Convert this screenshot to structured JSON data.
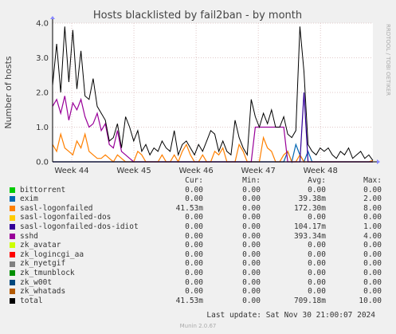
{
  "chart_data": {
    "type": "line",
    "title": "Hosts blacklisted by fail2ban - by month",
    "ylabel": "Number of hosts",
    "ylim": [
      0,
      4
    ],
    "yticks": [
      "0.0",
      "1.0",
      "2.0",
      "3.0",
      "4.0"
    ],
    "x_ticks": [
      "Week 44",
      "Week 45",
      "Week 46",
      "Week 47",
      "Week 48"
    ],
    "grid": true,
    "series": [
      {
        "name": "bittorrent",
        "color": "#00cc00",
        "values": [
          0,
          0,
          0,
          0,
          0,
          0,
          0,
          0,
          0,
          0,
          0,
          0,
          0,
          0,
          0,
          0,
          0,
          0,
          0,
          0,
          0,
          0,
          0,
          0,
          0,
          0,
          0,
          0,
          0,
          0,
          0,
          0,
          0,
          0,
          0,
          0,
          0,
          0,
          0,
          0,
          0,
          0,
          0,
          0,
          0,
          0,
          0,
          0,
          0,
          0,
          0,
          0,
          0,
          0,
          0,
          0,
          0,
          0,
          0,
          0,
          0,
          0,
          0,
          0,
          0,
          0,
          0,
          0,
          0,
          0,
          0,
          0,
          0,
          0,
          0,
          0,
          0,
          0,
          0,
          0
        ]
      },
      {
        "name": "exim",
        "color": "#0066b3",
        "values": [
          0,
          0,
          0,
          0,
          0,
          0,
          0,
          0,
          0,
          0,
          0,
          0,
          0,
          0,
          0,
          0,
          0,
          0,
          0,
          0,
          0,
          0,
          0,
          0,
          0,
          0,
          0,
          0,
          0,
          0,
          0,
          0,
          0,
          0,
          0,
          0,
          0,
          0,
          0,
          0,
          0,
          0,
          0,
          0,
          0,
          0,
          0,
          0,
          0,
          0,
          0,
          0,
          0,
          0,
          0,
          0,
          0,
          0,
          0.3,
          0,
          0.5,
          0.2,
          0,
          0.3,
          0,
          0,
          0,
          0,
          0,
          0,
          0,
          0,
          0,
          0,
          0,
          0,
          0,
          0,
          0,
          0
        ]
      },
      {
        "name": "sasl-logonfailed",
        "color": "#ff8000",
        "values": [
          0.5,
          0.3,
          0.8,
          0.4,
          0.3,
          0.2,
          0.6,
          0.4,
          0.8,
          0.3,
          0.2,
          0.1,
          0.1,
          0.2,
          0.1,
          0,
          0.2,
          0.1,
          0,
          0,
          0,
          0.3,
          0.2,
          0,
          0,
          0,
          0,
          0.2,
          0,
          0,
          0.2,
          0,
          0.3,
          0.5,
          0.2,
          0,
          0,
          0.2,
          0,
          0,
          0.3,
          0.2,
          0.4,
          0,
          0,
          0,
          0.5,
          0.3,
          0,
          0,
          0,
          0,
          0.7,
          0.4,
          0.3,
          0,
          0,
          0.2,
          0.3,
          0,
          0,
          0.2,
          0,
          0,
          0,
          0,
          0,
          0,
          0,
          0,
          0,
          0,
          0,
          0,
          0,
          0,
          0,
          0,
          0,
          0.04
        ]
      },
      {
        "name": "sasl-logonfailed-dos",
        "color": "#ffcc00",
        "values": [
          0,
          0,
          0,
          0,
          0,
          0,
          0,
          0,
          0,
          0,
          0,
          0,
          0,
          0,
          0,
          0,
          0,
          0,
          0,
          0,
          0,
          0,
          0,
          0,
          0,
          0,
          0,
          0,
          0,
          0,
          0,
          0,
          0,
          0,
          0,
          0,
          0,
          0,
          0,
          0,
          0,
          0,
          0,
          0,
          0,
          0,
          0,
          0,
          0,
          0,
          0,
          0,
          0,
          0,
          0,
          0,
          0,
          0,
          0,
          0,
          0,
          0,
          0,
          0,
          0,
          0,
          0,
          0,
          0,
          0,
          0,
          0,
          0,
          0,
          0,
          0,
          0,
          0,
          0,
          0
        ]
      },
      {
        "name": "sasl-logonfailed-dos-idiot",
        "color": "#330099",
        "values": [
          0,
          0,
          0,
          0,
          0,
          0,
          0,
          0,
          0,
          0,
          0,
          0,
          0,
          0,
          0,
          0,
          0,
          0,
          0,
          0,
          0,
          0,
          0,
          0,
          0,
          0,
          0,
          0,
          0,
          0,
          0,
          0,
          0,
          0,
          0,
          0,
          0,
          0,
          0,
          0,
          0,
          0,
          0,
          0,
          0,
          0,
          0,
          0,
          0,
          0,
          0,
          0,
          0,
          0,
          0,
          0,
          0,
          0,
          0,
          0,
          0,
          0,
          2.0,
          0,
          0,
          0,
          0,
          0,
          0,
          0,
          0,
          0,
          0,
          0,
          0,
          0,
          0,
          0,
          0,
          0
        ]
      },
      {
        "name": "sshd",
        "color": "#990099",
        "values": [
          1.6,
          1.8,
          1.4,
          1.9,
          1.2,
          1.7,
          1.5,
          1.8,
          1.3,
          1.0,
          1.1,
          1.4,
          0.9,
          1.1,
          0.5,
          0.4,
          0.9,
          0.3,
          0.2,
          0.1,
          0,
          0,
          0,
          0,
          0,
          0,
          0,
          0,
          0,
          0,
          0,
          0,
          0,
          0,
          0,
          0,
          0,
          0,
          0,
          0,
          0,
          0,
          0,
          0,
          0,
          0,
          0,
          0,
          0,
          0,
          1.0,
          1.0,
          1.0,
          1.0,
          1.0,
          1.0,
          1.0,
          1.0,
          0,
          0,
          0,
          0,
          0,
          0,
          0,
          0,
          0,
          0,
          0,
          0,
          0,
          0,
          0,
          0,
          0,
          0,
          0,
          0,
          0,
          0
        ]
      },
      {
        "name": "zk_avatar",
        "color": "#ccff00",
        "values": [
          0,
          0,
          0,
          0,
          0,
          0,
          0,
          0,
          0,
          0,
          0,
          0,
          0,
          0,
          0,
          0,
          0,
          0,
          0,
          0,
          0,
          0,
          0,
          0,
          0,
          0,
          0,
          0,
          0,
          0,
          0,
          0,
          0,
          0,
          0,
          0,
          0,
          0,
          0,
          0,
          0,
          0,
          0,
          0,
          0,
          0,
          0,
          0,
          0,
          0,
          0,
          0,
          0,
          0,
          0,
          0,
          0,
          0,
          0,
          0,
          0,
          0,
          0,
          0,
          0,
          0,
          0,
          0,
          0,
          0,
          0,
          0,
          0,
          0,
          0,
          0,
          0,
          0,
          0,
          0
        ]
      },
      {
        "name": "zk_logincgi_aa",
        "color": "#ff0000",
        "values": [
          0,
          0,
          0,
          0,
          0,
          0,
          0,
          0,
          0,
          0,
          0,
          0,
          0,
          0,
          0,
          0,
          0,
          0,
          0,
          0,
          0,
          0,
          0,
          0,
          0,
          0,
          0,
          0,
          0,
          0,
          0,
          0,
          0,
          0,
          0,
          0,
          0,
          0,
          0,
          0,
          0,
          0,
          0,
          0,
          0,
          0,
          0,
          0,
          0,
          0,
          0,
          0,
          0,
          0,
          0,
          0,
          0,
          0,
          0,
          0,
          0,
          0,
          0,
          0,
          0,
          0,
          0,
          0,
          0,
          0,
          0,
          0,
          0,
          0,
          0,
          0,
          0,
          0,
          0,
          0
        ]
      },
      {
        "name": "zk_nyetgif",
        "color": "#808080",
        "values": [
          0,
          0,
          0,
          0,
          0,
          0,
          0,
          0,
          0,
          0,
          0,
          0,
          0,
          0,
          0,
          0,
          0,
          0,
          0,
          0,
          0,
          0,
          0,
          0,
          0,
          0,
          0,
          0,
          0,
          0,
          0,
          0,
          0,
          0,
          0,
          0,
          0,
          0,
          0,
          0,
          0,
          0,
          0,
          0,
          0,
          0,
          0,
          0,
          0,
          0,
          0,
          0,
          0,
          0,
          0,
          0,
          0,
          0,
          0,
          0,
          0,
          0,
          0,
          0,
          0,
          0,
          0,
          0,
          0,
          0,
          0,
          0,
          0,
          0,
          0,
          0,
          0,
          0,
          0,
          0
        ]
      },
      {
        "name": "zk_tmunblock",
        "color": "#008f00",
        "values": [
          0,
          0,
          0,
          0,
          0,
          0,
          0,
          0,
          0,
          0,
          0,
          0,
          0,
          0,
          0,
          0,
          0,
          0,
          0,
          0,
          0,
          0,
          0,
          0,
          0,
          0,
          0,
          0,
          0,
          0,
          0,
          0,
          0,
          0,
          0,
          0,
          0,
          0,
          0,
          0,
          0,
          0,
          0,
          0,
          0,
          0,
          0,
          0,
          0,
          0,
          0,
          0,
          0,
          0,
          0,
          0,
          0,
          0,
          0,
          0,
          0,
          0,
          0,
          0,
          0,
          0,
          0,
          0,
          0,
          0,
          0,
          0,
          0,
          0,
          0,
          0,
          0,
          0,
          0,
          0
        ]
      },
      {
        "name": "zk_w00t",
        "color": "#00487d",
        "values": [
          0,
          0,
          0,
          0,
          0,
          0,
          0,
          0,
          0,
          0,
          0,
          0,
          0,
          0,
          0,
          0,
          0,
          0,
          0,
          0,
          0,
          0,
          0,
          0,
          0,
          0,
          0,
          0,
          0,
          0,
          0,
          0,
          0,
          0,
          0,
          0,
          0,
          0,
          0,
          0,
          0,
          0,
          0,
          0,
          0,
          0,
          0,
          0,
          0,
          0,
          0,
          0,
          0,
          0,
          0,
          0,
          0,
          0,
          0,
          0,
          0,
          0,
          0,
          0,
          0,
          0,
          0,
          0,
          0,
          0,
          0,
          0,
          0,
          0,
          0,
          0,
          0,
          0,
          0,
          0
        ]
      },
      {
        "name": "zk_whatads",
        "color": "#b35a00",
        "values": [
          0,
          0,
          0,
          0,
          0,
          0,
          0,
          0,
          0,
          0,
          0,
          0,
          0,
          0,
          0,
          0,
          0,
          0,
          0,
          0,
          0,
          0,
          0,
          0,
          0,
          0,
          0,
          0,
          0,
          0,
          0,
          0,
          0,
          0,
          0,
          0,
          0,
          0,
          0,
          0,
          0,
          0,
          0,
          0,
          0,
          0,
          0,
          0,
          0,
          0,
          0,
          0,
          0,
          0,
          0,
          0,
          0,
          0,
          0,
          0,
          0,
          0,
          0,
          0,
          0,
          0,
          0,
          0,
          0,
          0,
          0,
          0,
          0,
          0,
          0,
          0,
          0,
          0,
          0,
          0
        ]
      },
      {
        "name": "total",
        "color": "#000000",
        "values": [
          2.2,
          3.4,
          2.0,
          3.9,
          2.3,
          3.8,
          2.1,
          3.2,
          1.9,
          1.8,
          2.4,
          1.6,
          1.4,
          1.2,
          0.6,
          0.7,
          1.1,
          0.4,
          1.3,
          1.0,
          0.6,
          0.9,
          0.3,
          0.5,
          0.2,
          0.4,
          0.3,
          0.6,
          0.4,
          0.3,
          0.9,
          0.2,
          0.5,
          0.6,
          0.4,
          0.2,
          0.5,
          0.3,
          0.6,
          0.9,
          0.8,
          0.3,
          0.6,
          0.3,
          0.2,
          1.2,
          0.7,
          0.4,
          0.2,
          1.8,
          1.3,
          1.0,
          1.4,
          1.1,
          1.5,
          1.0,
          1.0,
          1.3,
          0.8,
          0.7,
          0.9,
          3.9,
          2.6,
          0.5,
          0.3,
          0.2,
          0.4,
          0.3,
          0.4,
          0.2,
          0.1,
          0.3,
          0.2,
          0.4,
          0.1,
          0.2,
          0.3,
          0.1,
          0.2,
          0.04
        ]
      }
    ]
  },
  "side_label": "RRDTOOL / TOBI OETIKER",
  "legend": {
    "headers": {
      "cur": "Cur:",
      "min": "Min:",
      "avg": "Avg:",
      "max": "Max:"
    },
    "rows": [
      {
        "name": "bittorrent",
        "color": "#00cc00",
        "cur": "0.00",
        "min": "0.00",
        "avg": "0.00",
        "max": "0.00"
      },
      {
        "name": "exim",
        "color": "#0066b3",
        "cur": "0.00",
        "min": "0.00",
        "avg": "39.38m",
        "max": "2.00"
      },
      {
        "name": "sasl-logonfailed",
        "color": "#ff8000",
        "cur": "41.53m",
        "min": "0.00",
        "avg": "172.30m",
        "max": "8.00"
      },
      {
        "name": "sasl-logonfailed-dos",
        "color": "#ffcc00",
        "cur": "0.00",
        "min": "0.00",
        "avg": "0.00",
        "max": "0.00"
      },
      {
        "name": "sasl-logonfailed-dos-idiot",
        "color": "#330099",
        "cur": "0.00",
        "min": "0.00",
        "avg": "104.17m",
        "max": "1.00"
      },
      {
        "name": "sshd",
        "color": "#990099",
        "cur": "0.00",
        "min": "0.00",
        "avg": "393.34m",
        "max": "4.00"
      },
      {
        "name": "zk_avatar",
        "color": "#ccff00",
        "cur": "0.00",
        "min": "0.00",
        "avg": "0.00",
        "max": "0.00"
      },
      {
        "name": "zk_logincgi_aa",
        "color": "#ff0000",
        "cur": "0.00",
        "min": "0.00",
        "avg": "0.00",
        "max": "0.00"
      },
      {
        "name": "zk_nyetgif",
        "color": "#808080",
        "cur": "0.00",
        "min": "0.00",
        "avg": "0.00",
        "max": "0.00"
      },
      {
        "name": "zk_tmunblock",
        "color": "#008f00",
        "cur": "0.00",
        "min": "0.00",
        "avg": "0.00",
        "max": "0.00"
      },
      {
        "name": "zk_w00t",
        "color": "#00487d",
        "cur": "0.00",
        "min": "0.00",
        "avg": "0.00",
        "max": "0.00"
      },
      {
        "name": "zk_whatads",
        "color": "#b35a00",
        "cur": "0.00",
        "min": "0.00",
        "avg": "0.00",
        "max": "0.00"
      },
      {
        "name": "total",
        "color": "#000000",
        "cur": "41.53m",
        "min": "0.00",
        "avg": "709.18m",
        "max": "10.00"
      }
    ]
  },
  "last_update": "Last update: Sat Nov 30 21:00:07 2024",
  "munin_version": "Munin 2.0.67"
}
